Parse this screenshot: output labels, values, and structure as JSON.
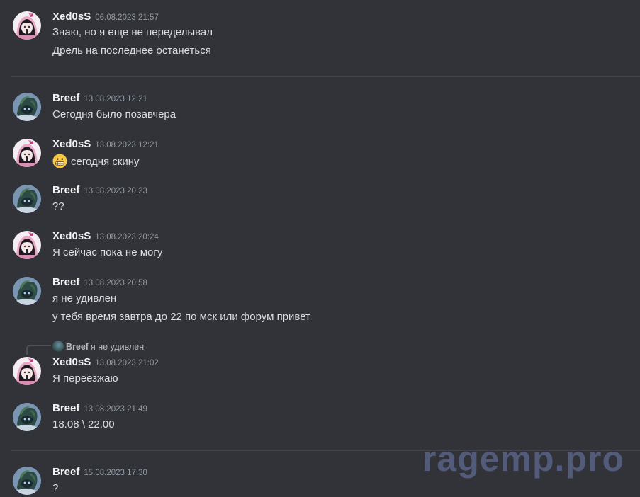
{
  "messages": [
    {
      "author": "Xed0sS",
      "timestamp": "06.08.2023 21:57",
      "lines": [
        "Знаю, но я еще не переделывал",
        "Дрель на последнее останеться"
      ]
    },
    {
      "author": "Breef",
      "timestamp": "13.08.2023 12:21",
      "lines": [
        "Сегодня было позавчера"
      ]
    },
    {
      "author": "Xed0sS",
      "timestamp": "13.08.2023 12:21",
      "emoji": "grimacing-face-emoji",
      "lines": [
        "сегодня скину"
      ]
    },
    {
      "author": "Breef",
      "timestamp": "13.08.2023 20:23",
      "lines": [
        "??"
      ]
    },
    {
      "author": "Xed0sS",
      "timestamp": "13.08.2023 20:24",
      "lines": [
        "Я сейчас пока не могу"
      ]
    },
    {
      "author": "Breef",
      "timestamp": "13.08.2023 20:58",
      "lines": [
        "я не удивлен",
        "у тебя время завтра до 22 по мск или форум привет"
      ]
    },
    {
      "author": "Xed0sS",
      "timestamp": "13.08.2023 21:02",
      "reply": {
        "author": "Breef",
        "text": "я не удивлен"
      },
      "lines": [
        "Я переезжаю"
      ]
    },
    {
      "author": "Breef",
      "timestamp": "13.08.2023 21:49",
      "lines": [
        "18.08 \\ 22.00"
      ]
    },
    {
      "author": "Breef",
      "timestamp": "15.08.2023 17:30",
      "lines": [
        "?"
      ]
    }
  ],
  "watermark": "ragemp.pro",
  "colors": {
    "background": "#313338",
    "text": "#dbdee1",
    "author": "#f2f3f5",
    "timestamp": "#949ba4",
    "divider": "#3f4147",
    "watermark": "#5a6287"
  }
}
